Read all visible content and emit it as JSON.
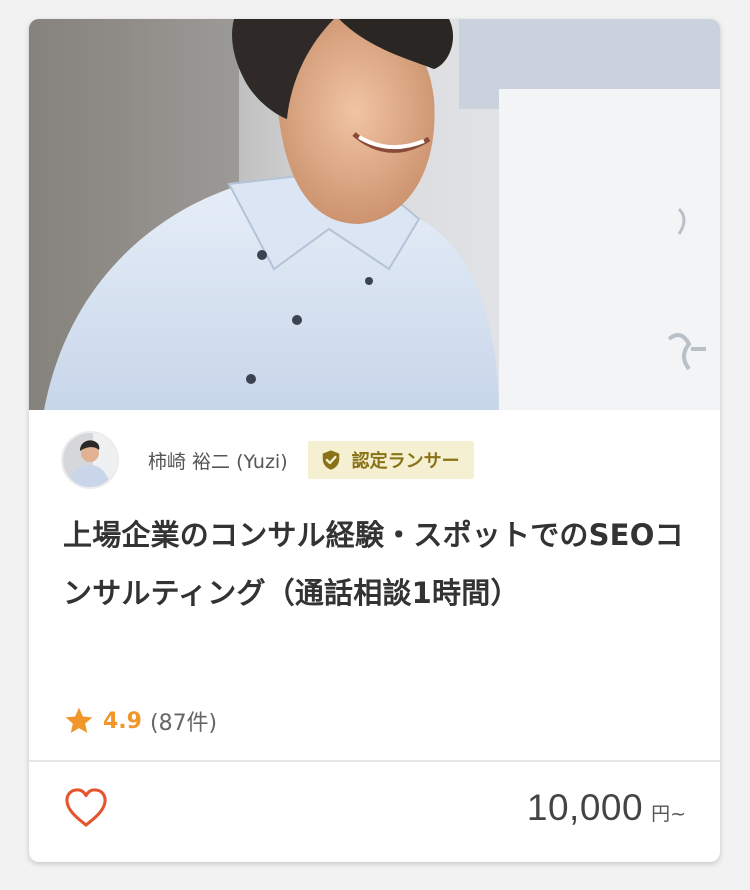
{
  "card": {
    "hero_image": "hero-photo",
    "seller": {
      "avatar": "seller-avatar",
      "name": "柿崎 裕二 (Yuzi)",
      "badge_icon": "shield-check-icon",
      "badge_label": "認定ランサー"
    },
    "title": "上場企業のコンサル経験・スポットでのSEOコンサルティング（通話相談1時間）",
    "rating": {
      "icon": "star-icon",
      "value": "4.9",
      "count": "(87件)"
    },
    "favorite_icon": "heart-outline-icon",
    "price": {
      "value": "10,000",
      "unit": "円~"
    }
  },
  "colors": {
    "accent_orange": "#f0962a",
    "heart": "#e4542d",
    "badge_bg": "#f5f0d2",
    "badge_text": "#8a7218",
    "title_text": "#333333"
  }
}
